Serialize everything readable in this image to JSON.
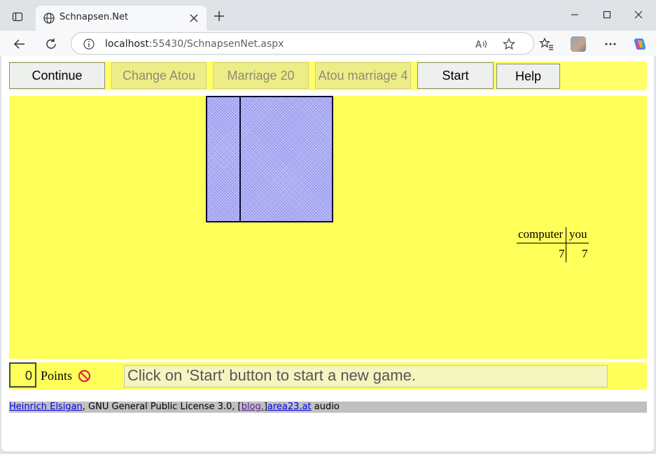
{
  "browser": {
    "tab_title": "Schnapsen.Net",
    "url_host": "localhost",
    "url_rest": ":55430/SchnapsenNet.aspx"
  },
  "game": {
    "buttons": {
      "continue": "Continue",
      "change_atou": "Change Atou",
      "marriage_20": "Marriage 20",
      "atou_marriage": "Atou marriage 4",
      "start": "Start",
      "help": "Help"
    },
    "score": {
      "computer_label": "computer",
      "you_label": "you",
      "computer_value": "7",
      "you_value": "7"
    },
    "points_value": "0",
    "points_label": "Points",
    "status_message": "Click on 'Start' button to start a new game."
  },
  "footer": {
    "author_link": "Heinrich Elsigan",
    "license_text": ", GNU General Public License 3.0, [",
    "blog_link": "blog.",
    "bracket_close": "]",
    "site_link": "area23.at",
    "audio_text": " audio"
  },
  "colors": {
    "table_bg": "#ffff5a",
    "card_back": "#c4c4ff",
    "disabled_button": "#eded88"
  }
}
